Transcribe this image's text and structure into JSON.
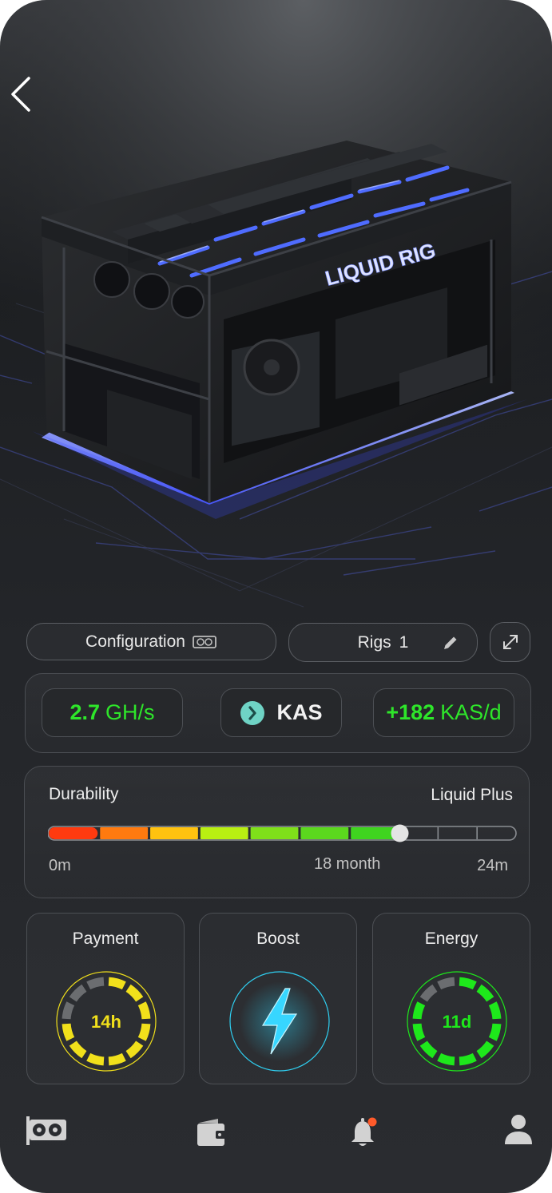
{
  "hero": {
    "rig_label": "LIQUID RIG"
  },
  "actions": {
    "configuration_label": "Configuration",
    "rigs_label": "Rigs",
    "rigs_count": "1"
  },
  "stats": {
    "hashrate_value": "2.7",
    "hashrate_unit": "GH/s",
    "coin": "KAS",
    "earnings_value": "+182",
    "earnings_unit": "KAS/d"
  },
  "durability": {
    "label": "Durability",
    "plan": "Liquid Plus",
    "start_label": "0m",
    "current_label": "18 month",
    "end_label": "24m",
    "progress_months": 18,
    "total_months": 24,
    "segment_colors": [
      "#ff3a0f",
      "#ff7a0f",
      "#ffc20f",
      "#b9ef12",
      "#7fe01a",
      "#5bd81e",
      "#3fd41f"
    ]
  },
  "cards": {
    "payment": {
      "title": "Payment",
      "value": "14h",
      "color": "#f1e01b"
    },
    "boost": {
      "title": "Boost",
      "color": "#2fd0f2"
    },
    "energy": {
      "title": "Energy",
      "value": "11d",
      "color": "#1ee81b"
    }
  },
  "nav": {
    "items": [
      "rigs-icon",
      "wallet-icon",
      "bell-icon",
      "profile-icon"
    ],
    "notification_color": "#ff5a2a"
  }
}
